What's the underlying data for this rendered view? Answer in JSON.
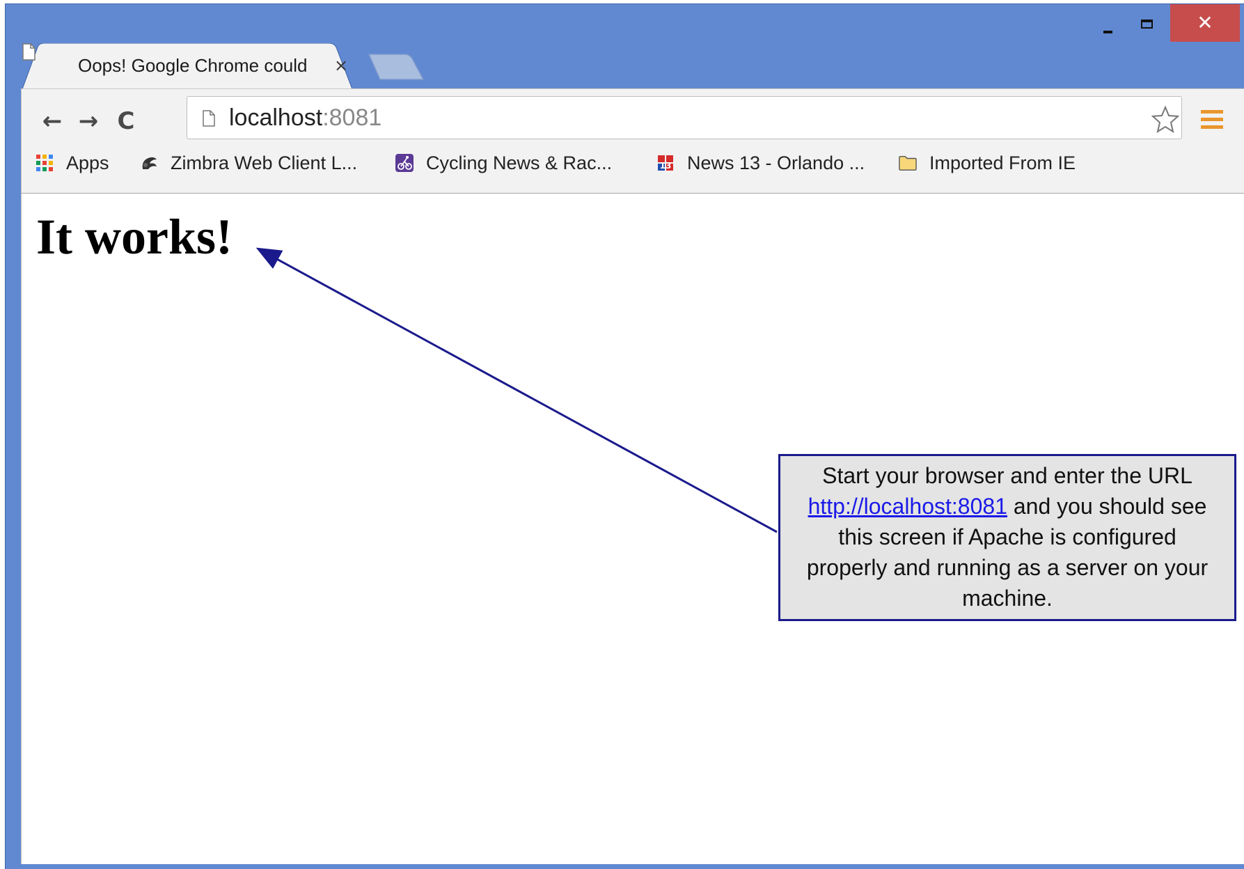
{
  "window": {
    "controls": {
      "minimize_icon": "minimize-icon",
      "maximize_icon": "maximize-icon",
      "close_label": "✕"
    },
    "frame_color": "#6189d2",
    "close_color": "#c74d4d"
  },
  "tab": {
    "title": "Oops! Google Chrome could not connect",
    "close_label": "×",
    "icon": "document-icon"
  },
  "toolbar": {
    "back_label": "←",
    "forward_label": "→",
    "reload_label": "C",
    "url_host": "localhost",
    "url_port": ":8081",
    "star_icon": "star-icon",
    "menu_icon": "menu-icon",
    "menu_color": "#e9962c"
  },
  "bookmarks": [
    {
      "label": "Apps",
      "icon": "apps-grid-icon"
    },
    {
      "label": "Zimbra Web Client L...",
      "icon": "zimbra-icon"
    },
    {
      "label": "Cycling News & Rac...",
      "icon": "cycling-icon"
    },
    {
      "label": "News 13 - Orlando ...",
      "icon": "news13-icon"
    },
    {
      "label": "Imported From IE",
      "icon": "folder-icon"
    }
  ],
  "page": {
    "heading": "It works!"
  },
  "callout": {
    "text_before": "Start your browser and enter the URL ",
    "link": "http://localhost:8081",
    "text_after": " and you should see this screen if Apache is configured properly and running as a server on your machine.",
    "border_color": "#1a1a8c"
  }
}
